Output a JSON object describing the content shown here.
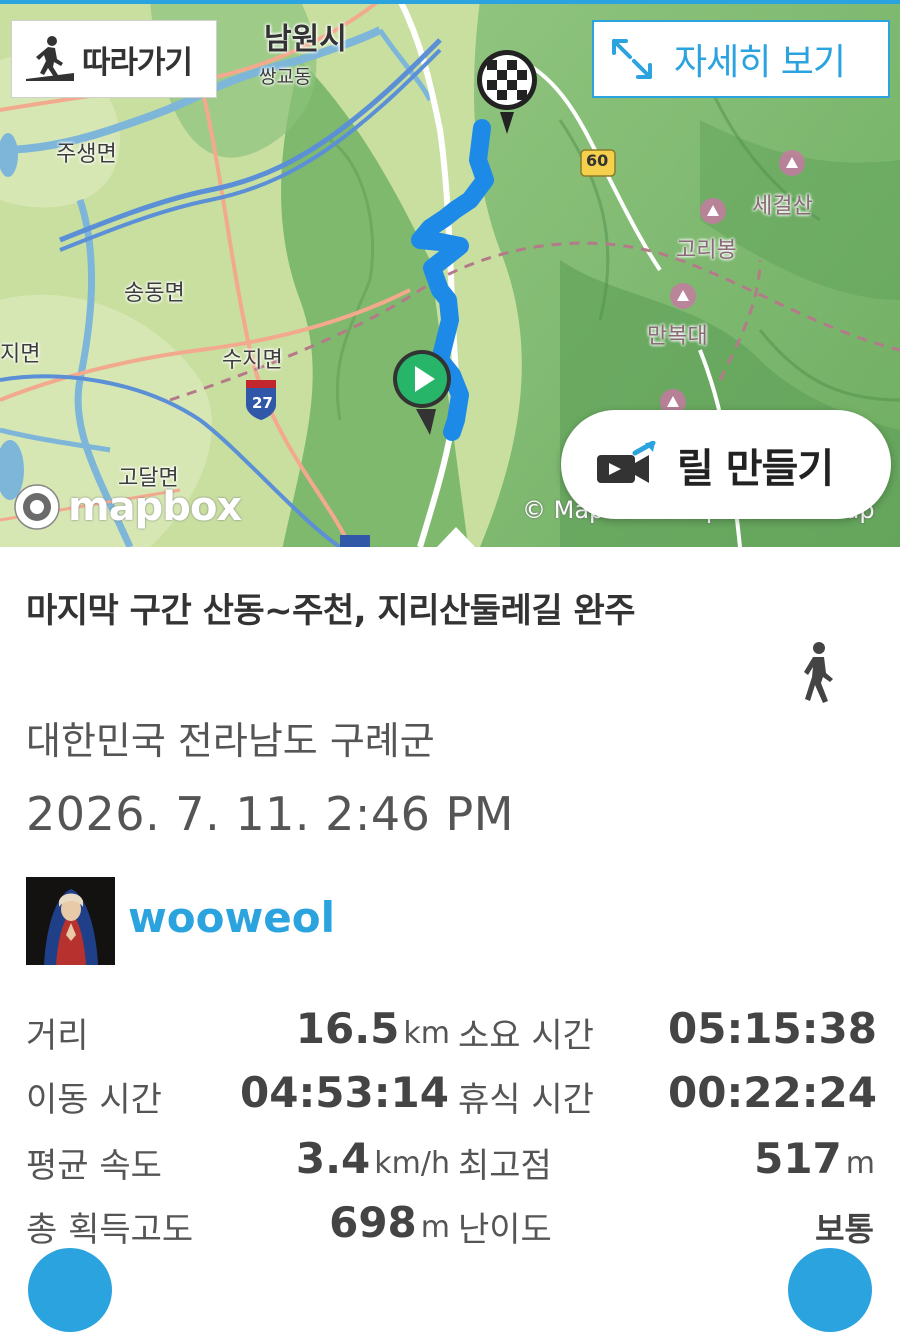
{
  "map": {
    "follow_label": "따라가기",
    "detail_label": "자세히 보기",
    "reels_label": "릴 만들기",
    "mapbox_label": "mapbox",
    "copyright": "© Mapbox © OpenStreetMap",
    "places": {
      "namwon": "남원시",
      "ssanggyo": "쌍교동",
      "jusaeng": "주생면",
      "songdong": "송동면",
      "jimyeon": "지면",
      "suji": "수지면",
      "godal": "고달면",
      "segeolsan": "세걸산",
      "goribong": "고리봉",
      "manbokdae": "만복대",
      "route60": "60",
      "route27": "27"
    },
    "route_color": "#1e8ae8",
    "accent_color": "#2aa3df"
  },
  "activity": {
    "title": "마지막 구간 산동~주천, 지리산둘레길 완주",
    "location": "대한민국 전라남도 구례군",
    "datetime": "2026. 7. 11. 2:46 PM",
    "username": "wooweol",
    "type_icon": "walking-person-icon"
  },
  "stats": {
    "distance_label": "거리",
    "distance_value": "16.5",
    "distance_unit": "km",
    "total_time_label": "소요 시간",
    "total_time_value": "05:15:38",
    "moving_time_label": "이동 시간",
    "moving_time_value": "04:53:14",
    "rest_time_label": "휴식 시간",
    "rest_time_value": "00:22:24",
    "avg_speed_label": "평균 속도",
    "avg_speed_value": "3.4",
    "avg_speed_unit": "km/h",
    "max_alt_label": "최고점",
    "max_alt_value": "517",
    "max_alt_unit": "m",
    "gain_label": "총 획득고도",
    "gain_value": "698",
    "gain_unit": "m",
    "difficulty_label": "난이도",
    "difficulty_value": "보통"
  }
}
